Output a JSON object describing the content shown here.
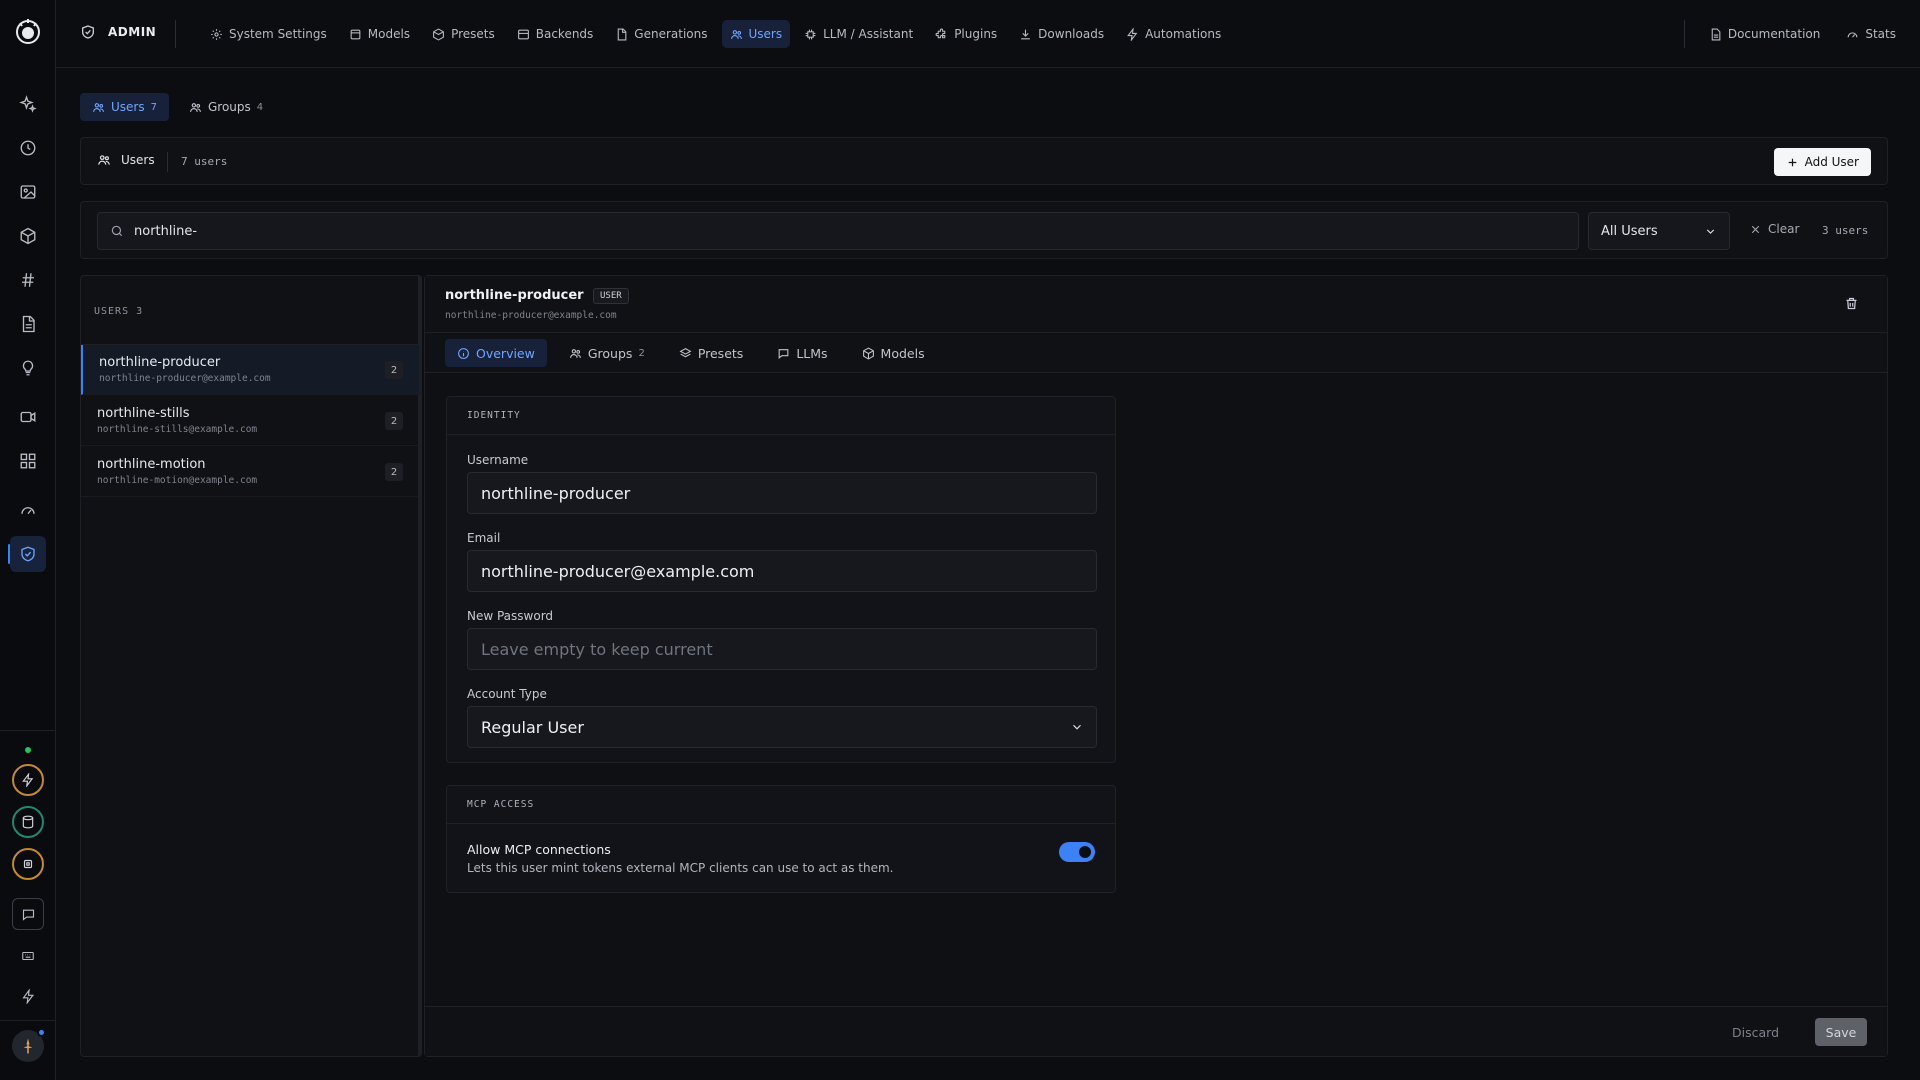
{
  "topbar": {
    "section": "ADMIN",
    "nav": [
      {
        "label": "System Settings",
        "icon": "gear-icon"
      },
      {
        "label": "Models",
        "icon": "box-icon"
      },
      {
        "label": "Presets",
        "icon": "layers-icon"
      },
      {
        "label": "Backends",
        "icon": "server-icon"
      },
      {
        "label": "Generations",
        "icon": "file-icon"
      },
      {
        "label": "Users",
        "icon": "users-icon",
        "active": true
      },
      {
        "label": "LLM / Assistant",
        "icon": "chip-icon"
      },
      {
        "label": "Plugins",
        "icon": "puzzle-icon"
      },
      {
        "label": "Downloads",
        "icon": "download-icon"
      },
      {
        "label": "Automations",
        "icon": "bolt-icon"
      }
    ],
    "right": [
      {
        "label": "Documentation",
        "icon": "doc-icon"
      },
      {
        "label": "Stats",
        "icon": "gauge-icon"
      }
    ]
  },
  "subtabs": {
    "users_label": "Users",
    "users_count": "7",
    "groups_label": "Groups",
    "groups_count": "4"
  },
  "users_bar": {
    "title": "Users",
    "count": "7 users",
    "add_label": "Add User"
  },
  "filter": {
    "search_value": "northline-",
    "role_select": "All Users",
    "clear_label": "Clear",
    "result_count": "3 users"
  },
  "list": {
    "header": "USERS 3",
    "users": [
      {
        "name": "northline-producer",
        "email": "northline-producer@example.com",
        "count": "2"
      },
      {
        "name": "northline-stills",
        "email": "northline-stills@example.com",
        "count": "2"
      },
      {
        "name": "northline-motion",
        "email": "northline-motion@example.com",
        "count": "2"
      }
    ]
  },
  "detail": {
    "username": "northline-producer",
    "role": "USER",
    "email": "northline-producer@example.com",
    "tabs": {
      "overview": "Overview",
      "groups": "Groups",
      "groups_count": "2",
      "presets": "Presets",
      "llms": "LLMs",
      "models": "Models"
    },
    "identity": {
      "title": "IDENTITY",
      "username_label": "Username",
      "username_value": "northline-producer",
      "email_label": "Email",
      "email_value": "northline-producer@example.com",
      "password_label": "New Password",
      "password_placeholder": "Leave empty to keep current",
      "account_type_label": "Account Type",
      "account_type_value": "Regular User"
    },
    "mcp": {
      "title": "MCP ACCESS",
      "toggle_label": "Allow MCP connections",
      "toggle_desc": "Lets this user mint tokens external MCP clients can use to act as them.",
      "enabled": true
    },
    "footer": {
      "discard": "Discard",
      "save": "Save"
    }
  },
  "colors": {
    "accent": "#3b82f6",
    "background": "#0c0d10",
    "success": "#22c55e"
  }
}
